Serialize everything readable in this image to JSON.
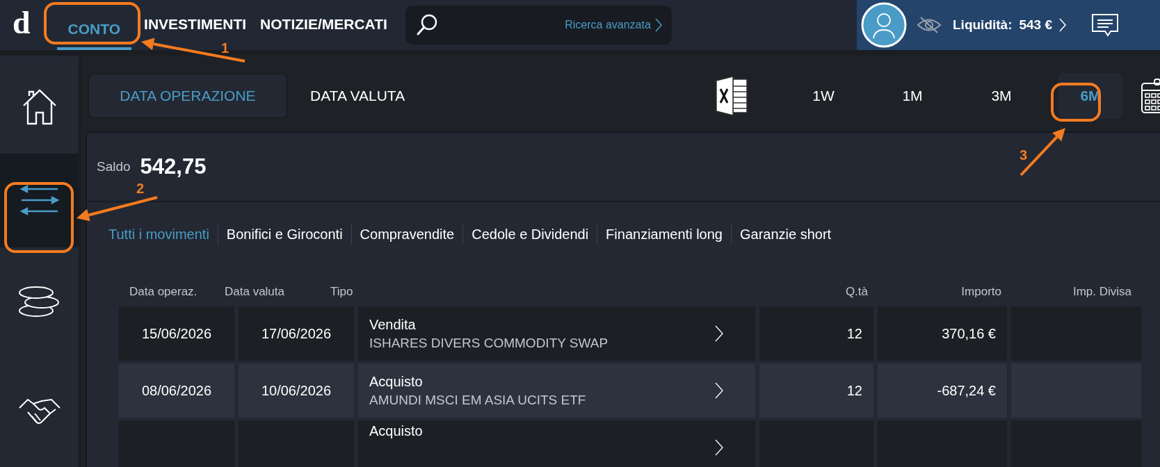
{
  "top_nav": {
    "logo": "d",
    "tabs": [
      {
        "label": "CONTO",
        "selected": true
      },
      {
        "label": "INVESTIMENTI",
        "selected": false
      },
      {
        "label": "NOTIZIE/MERCATI",
        "selected": false
      }
    ],
    "search": {
      "link": "Ricerca avanzata"
    },
    "account": {
      "label": "Liquidità:",
      "value": "543 €"
    }
  },
  "sidebar": {
    "items": [
      {
        "kind": "home",
        "selected": false
      },
      {
        "kind": "transfers",
        "selected": true
      },
      {
        "kind": "coins",
        "selected": false
      },
      {
        "kind": "handshake",
        "selected": false
      }
    ]
  },
  "date_toggle": [
    {
      "label": "DATA OPERAZIONE",
      "selected": true
    },
    {
      "label": "DATA VALUTA",
      "selected": false
    }
  ],
  "periods": [
    {
      "label": "1W",
      "selected": false
    },
    {
      "label": "1M",
      "selected": false
    },
    {
      "label": "3M",
      "selected": false
    },
    {
      "label": "6M",
      "selected": true
    }
  ],
  "balance": {
    "label": "Saldo",
    "value": "542,75"
  },
  "filters": [
    {
      "label": "Tutti i movimenti",
      "selected": true
    },
    {
      "label": "Bonifici e Giroconti",
      "selected": false
    },
    {
      "label": "Compravendite",
      "selected": false
    },
    {
      "label": "Cedole e Dividendi",
      "selected": false
    },
    {
      "label": "Finanziamenti long",
      "selected": false
    },
    {
      "label": "Garanzie short",
      "selected": false
    }
  ],
  "table": {
    "columns": [
      "Data operaz.",
      "Data valuta",
      "Tipo",
      "Q.tà",
      "Importo",
      "Imp. Divisa"
    ],
    "rows": [
      {
        "date_op": "15/06/2026",
        "date_val": "17/06/2026",
        "type": "Vendita",
        "instrument": "ISHARES DIVERS COMMODITY SWAP",
        "qty": "12",
        "amount": "370,16 €"
      },
      {
        "date_op": "08/06/2026",
        "date_val": "10/06/2026",
        "type": "Acquisto",
        "instrument": "AMUNDI MSCI EM ASIA UCITS ETF",
        "qty": "12",
        "amount": "-687,24 €"
      },
      {
        "type": "Acquisto"
      }
    ]
  },
  "annotations": [
    {
      "label": "1"
    },
    {
      "label": "2"
    },
    {
      "label": "3"
    }
  ]
}
